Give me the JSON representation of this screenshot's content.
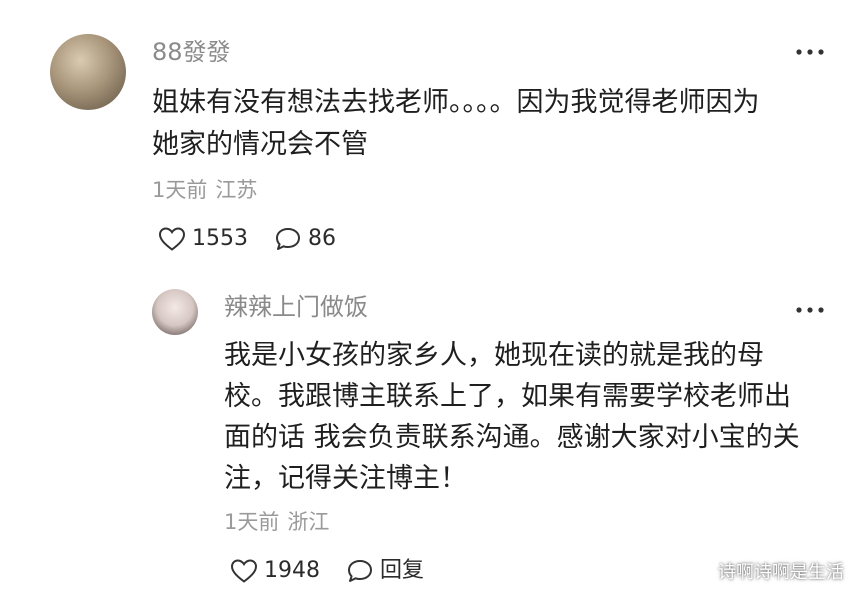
{
  "comment": {
    "username": "88發發",
    "text_lines": [
      "姐妹有没有想法去找老师。。。。因为我觉得老师因为",
      "她家的情况会不管"
    ],
    "time": "1天前",
    "location": "江苏",
    "likes": "1553",
    "replies": "86"
  },
  "reply": {
    "username": "辣辣上门做饭",
    "text_lines": [
      "我是小女孩的家乡人，她现在读的就是我的母",
      "校。我跟博主联系上了，如果有需要学校老师出",
      "面的话 我会负责联系沟通。感谢大家对小宝的关",
      "注，记得关注博主！"
    ],
    "time": "1天前",
    "location": "浙江",
    "likes": "1948",
    "reply_label": "回复"
  },
  "watermark": "诗啊诗啊是生活",
  "icons": {
    "like": "heart-outline-icon",
    "comment": "speech-bubble-icon",
    "more": "three-dots-icon"
  },
  "colors": {
    "text": "#1f1f1f",
    "username": "#8a8a8a",
    "meta": "#9a9a9a",
    "icon": "#333333"
  }
}
